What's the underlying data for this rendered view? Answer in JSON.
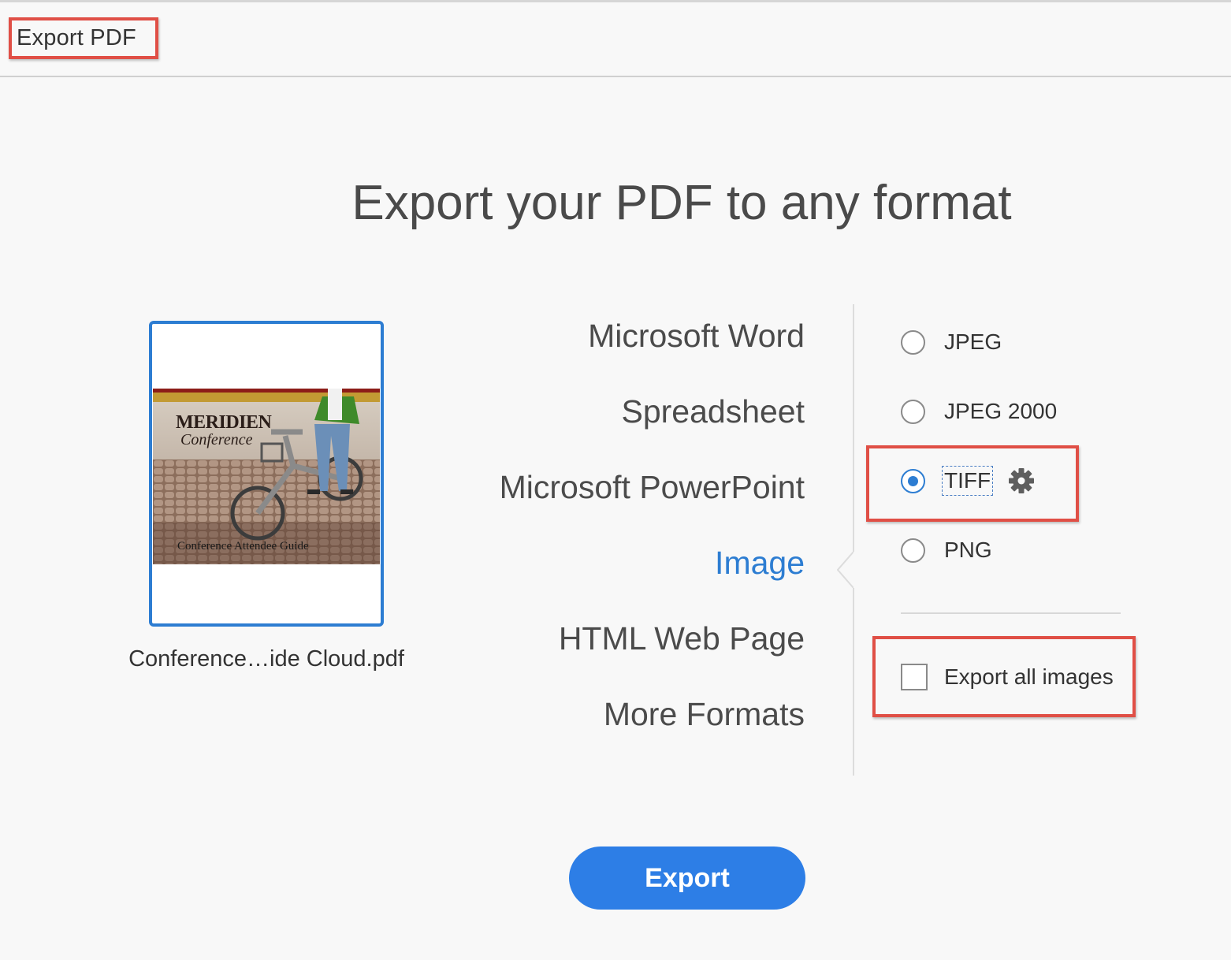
{
  "app": {
    "tool_title": "Export PDF",
    "heading": "Export your PDF to any format"
  },
  "document": {
    "file_name": "Conference…ide Cloud.pdf",
    "cover": {
      "brand": "MERIDIEN",
      "subtitle": "Conference",
      "caption": "Conference Attendee Guide"
    }
  },
  "formats": [
    {
      "label": "Microsoft Word",
      "selected": false
    },
    {
      "label": "Spreadsheet",
      "selected": false
    },
    {
      "label": "Microsoft PowerPoint",
      "selected": false
    },
    {
      "label": "Image",
      "selected": true
    },
    {
      "label": "HTML Web Page",
      "selected": false
    },
    {
      "label": "More Formats",
      "selected": false
    }
  ],
  "image_options": [
    {
      "label": "JPEG",
      "checked": false
    },
    {
      "label": "JPEG 2000",
      "checked": false
    },
    {
      "label": "TIFF",
      "checked": true,
      "has_settings": true
    },
    {
      "label": "PNG",
      "checked": false
    }
  ],
  "settings_icon": "gear-icon",
  "export_all_images": {
    "label": "Export all images",
    "checked": false
  },
  "export_button": {
    "label": "Export"
  },
  "colors": {
    "accent": "#2d7dd2",
    "button": "#2d7ee6",
    "highlight": "#e04f46",
    "background": "#f8f8f8"
  }
}
